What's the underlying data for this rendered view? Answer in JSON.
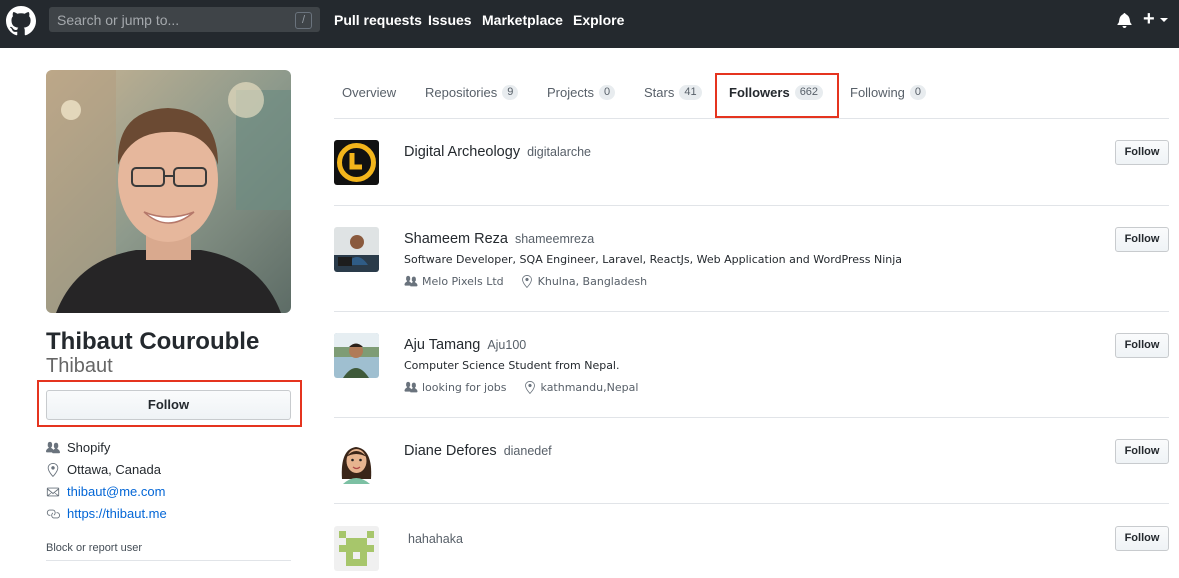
{
  "header": {
    "search_placeholder": "Search or jump to...",
    "search_shortcut": "/",
    "nav": [
      "Pull requests",
      "Issues",
      "Marketplace",
      "Explore"
    ],
    "plus_label": "+",
    "colors": {
      "background": "#24292e"
    },
    "icons": [
      "github-logo-icon",
      "bell-icon",
      "plus-icon",
      "caret-down-icon"
    ]
  },
  "profile": {
    "name": "Thibaut Courouble",
    "username": "Thibaut",
    "follow_label": "Follow",
    "company": "Shopify",
    "location": "Ottawa, Canada",
    "email": "thibaut@me.com",
    "website": "https://thibaut.me",
    "block_label": "Block or report user"
  },
  "tabs": [
    {
      "label": "Overview",
      "count": ""
    },
    {
      "label": "Repositories",
      "count": "9"
    },
    {
      "label": "Projects",
      "count": "0"
    },
    {
      "label": "Stars",
      "count": "41"
    },
    {
      "label": "Followers",
      "count": "662",
      "selected": true
    },
    {
      "label": "Following",
      "count": "0"
    }
  ],
  "followers": [
    {
      "name": "Digital Archeology",
      "login": "digitalarche",
      "bio": "",
      "company": "",
      "location": "",
      "follow_label": "Follow"
    },
    {
      "name": "Shameem Reza",
      "login": "shameemreza",
      "bio": "Software Developer, SQA Engineer, Laravel, ReactJs, Web Application and WordPress Ninja",
      "company": "Melo Pixels Ltd",
      "location": "Khulna, Bangladesh",
      "follow_label": "Follow"
    },
    {
      "name": "Aju Tamang",
      "login": "Aju100",
      "bio": "Computer Science Student from Nepal.",
      "company": "looking for jobs",
      "location": "kathmandu,Nepal",
      "follow_label": "Follow"
    },
    {
      "name": "Diane Defores",
      "login": "dianedef",
      "bio": "",
      "company": "",
      "location": "",
      "follow_label": "Follow"
    },
    {
      "name": "",
      "login": "hahahaka",
      "bio": "",
      "company": "",
      "location": "",
      "follow_label": "Follow"
    }
  ],
  "colors": {
    "link": "#0366d6",
    "highlight_box": "#e5341f",
    "counter_bg": "#e8ecef"
  }
}
